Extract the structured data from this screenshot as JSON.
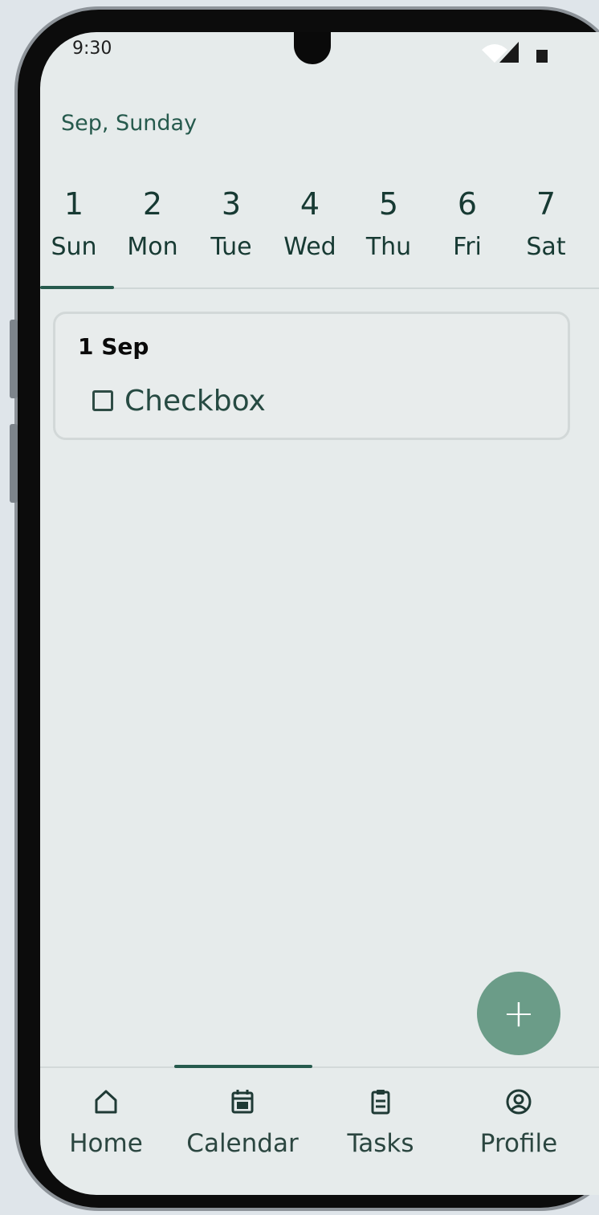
{
  "status_bar": {
    "time": "9:30"
  },
  "header": {
    "title": "Sep, Sunday"
  },
  "week": {
    "days": [
      {
        "num": "1",
        "name": "Sun"
      },
      {
        "num": "2",
        "name": "Mon"
      },
      {
        "num": "3",
        "name": "Tue"
      },
      {
        "num": "4",
        "name": "Wed"
      },
      {
        "num": "5",
        "name": "Thu"
      },
      {
        "num": "6",
        "name": "Fri"
      },
      {
        "num": "7",
        "name": "Sat"
      }
    ],
    "selected": "Sun"
  },
  "events": [
    {
      "date": "1 Sep",
      "tasks": [
        {
          "label": "Checkbox",
          "checked": false
        }
      ]
    }
  ],
  "fab": {
    "icon": "plus-icon",
    "symbol": "+"
  },
  "nav": {
    "items": [
      {
        "label": "Home",
        "icon": "home-icon"
      },
      {
        "label": "Calendar",
        "icon": "calendar-icon"
      },
      {
        "label": "Tasks",
        "icon": "clipboard-icon"
      },
      {
        "label": "Profile",
        "icon": "profile-icon"
      }
    ],
    "active": "Calendar"
  },
  "colors": {
    "accent": "#265a4d",
    "fab": "#6b9c88",
    "background": "#e6ebeb"
  }
}
